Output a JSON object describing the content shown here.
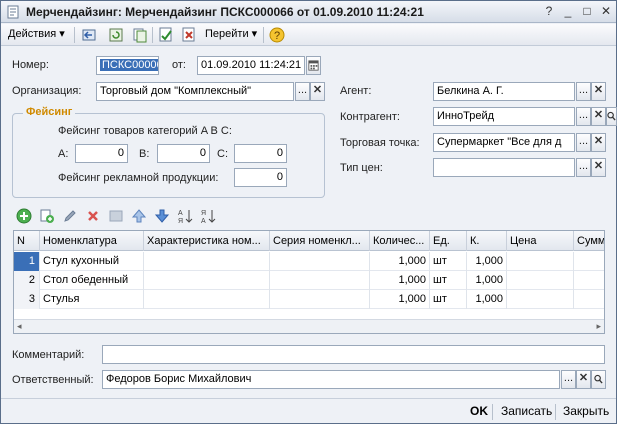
{
  "window": {
    "title": "Мерчендайзинг: Мерчендайзинг ПСКС000066 от 01.09.2010 11:24:21"
  },
  "toolbar": {
    "actions_label": "Действия",
    "goto_label": "Перейти"
  },
  "header": {
    "number_label": "Номер:",
    "number_value": "ПСКС00006",
    "date_label": "от:",
    "date_value": "01.09.2010 11:24:21",
    "org_label": "Организация:",
    "org_value": "Торговый дом \"Комплексный\"",
    "agent_label": "Агент:",
    "agent_value": "Белкина А. Г.",
    "counterparty_label": "Контрагент:",
    "counterparty_value": "ИнноТрейд",
    "outlet_label": "Торговая точка:",
    "outlet_value": "Супермаркет \"Все для д",
    "price_type_label": "Тип цен:",
    "price_type_value": ""
  },
  "facing": {
    "title": "Фейсинг",
    "categories_label": "Фейсинг товаров категорий A B C:",
    "a_label": "A:",
    "a_value": "0",
    "b_label": "B:",
    "b_value": "0",
    "c_label": "C:",
    "c_value": "0",
    "ads_label": "Фейсинг рекламной продукции:",
    "ads_value": "0"
  },
  "table": {
    "columns": [
      "N",
      "Номенклатура",
      "Характеристика ном...",
      "Серия номенкл...",
      "Количес...",
      "Ед.",
      "К.",
      "Цена",
      "Сумм"
    ],
    "rows": [
      {
        "n": "1",
        "item": "Стул кухонный",
        "char": "",
        "series": "",
        "qty": "1,000",
        "unit": "шт",
        "k": "1,000",
        "price": "",
        "sum": ""
      },
      {
        "n": "2",
        "item": "Стол обеденный",
        "char": "",
        "series": "",
        "qty": "1,000",
        "unit": "шт",
        "k": "1,000",
        "price": "",
        "sum": ""
      },
      {
        "n": "3",
        "item": "Стулья",
        "char": "",
        "series": "",
        "qty": "1,000",
        "unit": "шт",
        "k": "1,000",
        "price": "",
        "sum": ""
      }
    ]
  },
  "footer": {
    "comment_label": "Комментарий:",
    "comment_value": "",
    "responsible_label": "Ответственный:",
    "responsible_value": "Федоров Борис Михайлович"
  },
  "buttons": {
    "ok": "OK",
    "save": "Записать",
    "close": "Закрыть",
    "ellipsis": "...",
    "clear": "✕"
  },
  "colors": {
    "accent": "#3a6fb7",
    "group_title": "#d08a00"
  }
}
